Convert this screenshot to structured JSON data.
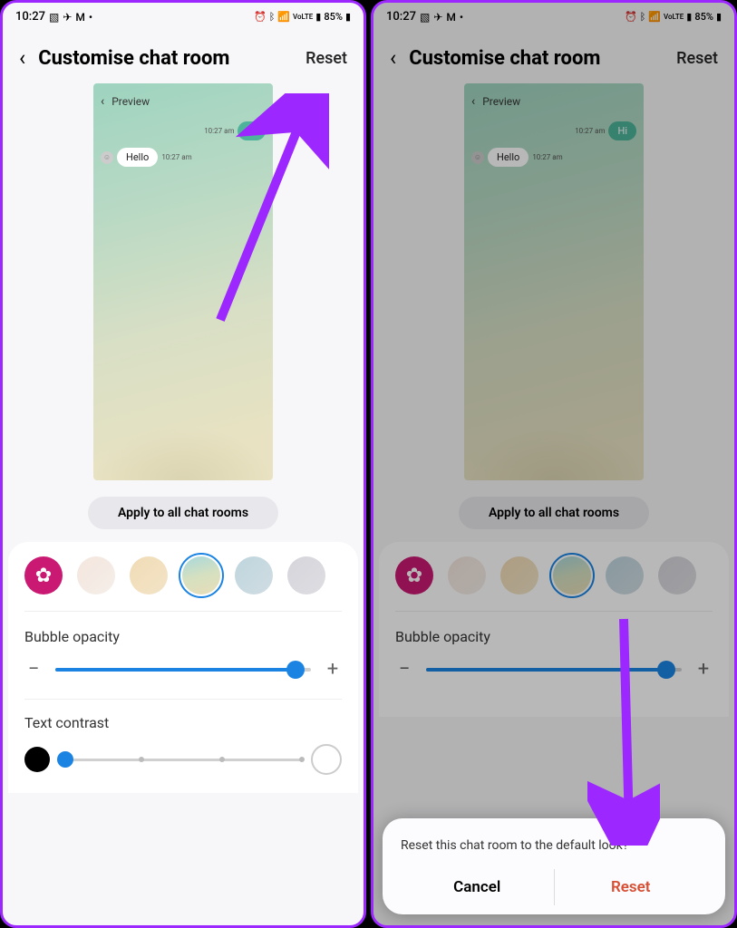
{
  "statusbar": {
    "time": "10:27",
    "battery": "85%"
  },
  "header": {
    "title": "Customise chat room",
    "reset": "Reset"
  },
  "preview": {
    "label": "Preview",
    "msg1": "Hi",
    "msg1_time": "10:27 am",
    "msg2": "Hello",
    "msg2_time": "10:27 am"
  },
  "apply": "Apply to all chat rooms",
  "sections": {
    "opacity": "Bubble opacity",
    "contrast": "Text contrast"
  },
  "slider": {
    "opacity_percent": 94
  },
  "dialog": {
    "message": "Reset this chat room to the default look?",
    "cancel": "Cancel",
    "reset": "Reset"
  }
}
